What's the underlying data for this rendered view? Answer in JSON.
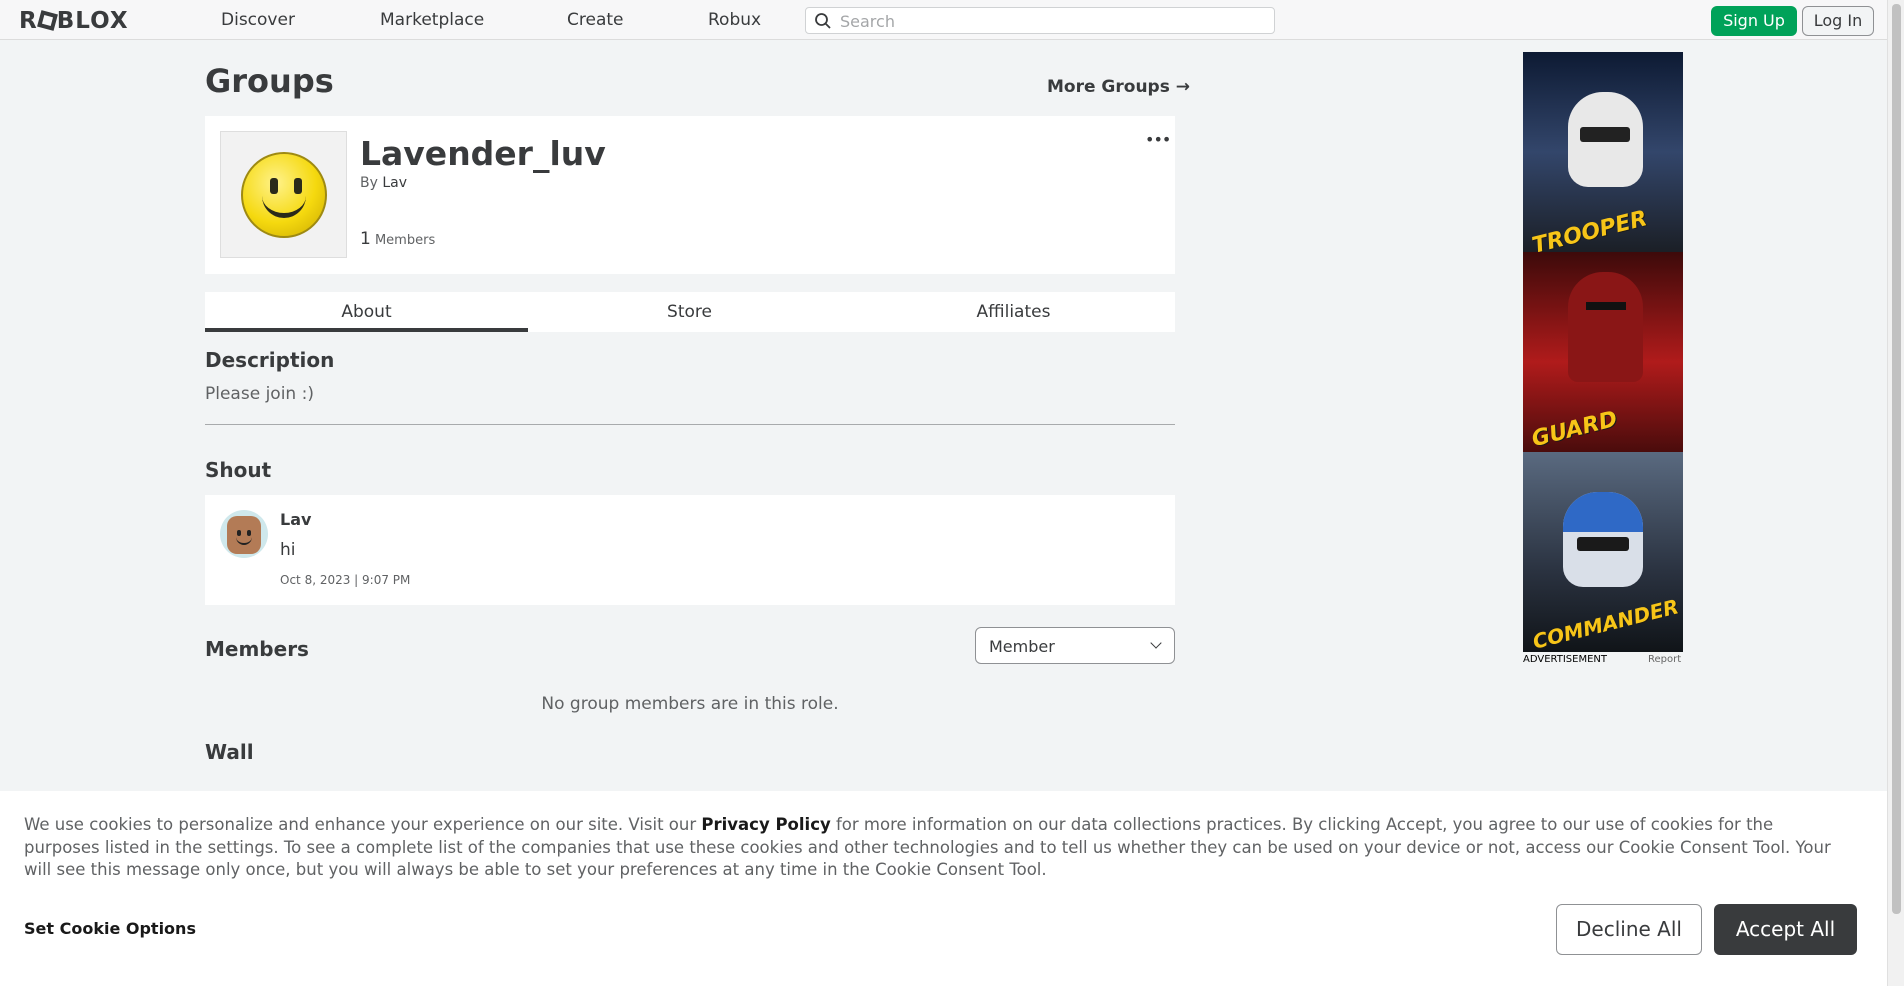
{
  "nav": {
    "logo": "ROBLOX",
    "links": [
      "Discover",
      "Marketplace",
      "Create",
      "Robux"
    ],
    "search_placeholder": "Search",
    "signup": "Sign Up",
    "login": "Log In"
  },
  "page": {
    "title": "Groups",
    "more_groups": "More Groups →"
  },
  "group": {
    "name": "Lavender_luv",
    "by_label": "By",
    "owner": "Lav",
    "member_count": "1",
    "members_label": "Members",
    "more_menu": "•••"
  },
  "tabs": [
    {
      "label": "About",
      "active": true
    },
    {
      "label": "Store",
      "active": false
    },
    {
      "label": "Affiliates",
      "active": false
    }
  ],
  "about": {
    "description_heading": "Description",
    "description": "Please join :)",
    "shout_heading": "Shout",
    "shout": {
      "user": "Lav",
      "text": "hi",
      "date": "Oct 8, 2023 | 9:07 PM"
    },
    "members_heading": "Members",
    "role_selected": "Member",
    "no_members": "No group members are in this role.",
    "wall_heading": "Wall"
  },
  "ad": {
    "panels": [
      "TROOPER",
      "GUARD",
      "COMMANDER"
    ],
    "label": "ADVERTISEMENT",
    "report": "Report"
  },
  "cookie": {
    "text_before": "We use cookies to personalize and enhance your experience on our site. Visit our ",
    "privacy_link": "Privacy Policy",
    "text_after": " for more information on our data collections practices. By clicking Accept, you agree to our use of cookies for the purposes listed in the settings. To see a complete list of the companies that use these cookies and other technologies and to tell us whether they can be used on your device or not, access our Cookie Consent Tool. Your will see this message only once, but you will always be able to set your preferences at any time in the Cookie Consent Tool.",
    "set_options": "Set Cookie Options",
    "decline": "Decline All",
    "accept": "Accept All"
  },
  "colors": {
    "signup_green": "#00a259",
    "accept_dark": "#393b3d",
    "page_bg": "#f2f4f5",
    "ad_label_yellow": "#f7c518"
  }
}
